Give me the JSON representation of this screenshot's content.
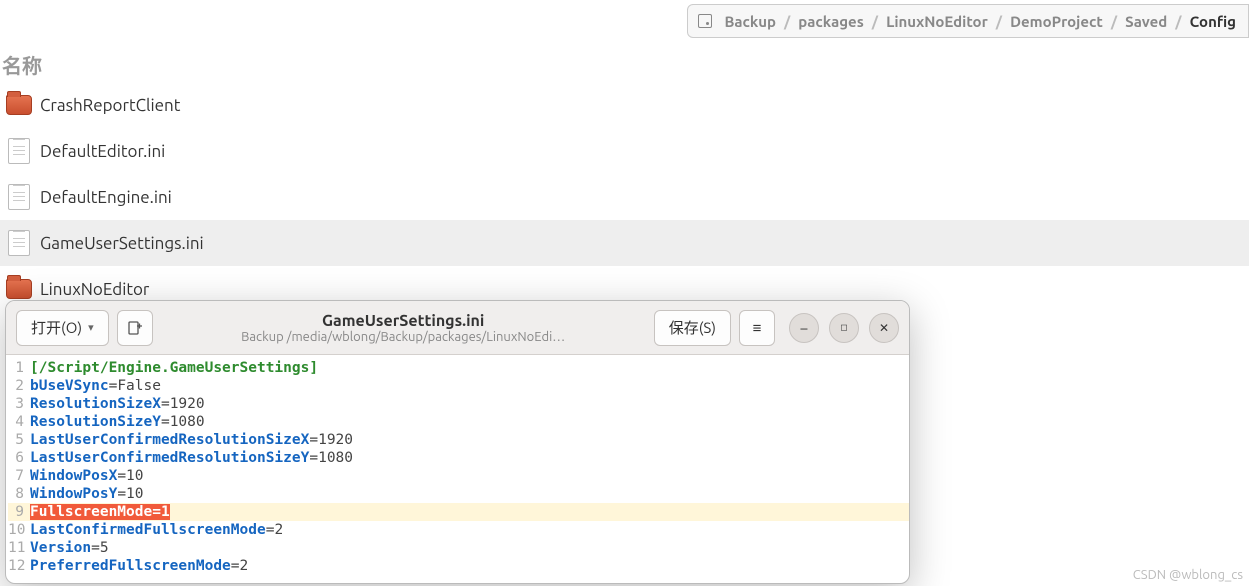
{
  "breadcrumb": {
    "items": [
      "Backup",
      "packages",
      "LinuxNoEditor",
      "DemoProject",
      "Saved",
      "Config"
    ]
  },
  "column_header": "名称",
  "files": [
    {
      "name": "CrashReportClient",
      "type": "folder"
    },
    {
      "name": "DefaultEditor.ini",
      "type": "file"
    },
    {
      "name": "DefaultEngine.ini",
      "type": "file"
    },
    {
      "name": "GameUserSettings.ini",
      "type": "file",
      "selected": true
    },
    {
      "name": "LinuxNoEditor",
      "type": "folder"
    }
  ],
  "editor": {
    "open_label": "打开(O)",
    "save_label": "保存(S)",
    "title": "GameUserSettings.ini",
    "subtitle": "Backup /media/wblong/Backup/packages/LinuxNoEdi…",
    "lines": [
      {
        "n": 1,
        "section": "[/Script/Engine.GameUserSettings]"
      },
      {
        "n": 2,
        "key": "bUseVSync",
        "val": "False"
      },
      {
        "n": 3,
        "key": "ResolutionSizeX",
        "val": "1920"
      },
      {
        "n": 4,
        "key": "ResolutionSizeY",
        "val": "1080"
      },
      {
        "n": 5,
        "key": "LastUserConfirmedResolutionSizeX",
        "val": "1920"
      },
      {
        "n": 6,
        "key": "LastUserConfirmedResolutionSizeY",
        "val": "1080"
      },
      {
        "n": 7,
        "key": "WindowPosX",
        "val": "10"
      },
      {
        "n": 8,
        "key": "WindowPosY",
        "val": "10"
      },
      {
        "n": 9,
        "key": "FullscreenMode",
        "val": "1",
        "highlight": true
      },
      {
        "n": 10,
        "key": "LastConfirmedFullscreenMode",
        "val": "2"
      },
      {
        "n": 11,
        "key": "Version",
        "val": "5"
      },
      {
        "n": 12,
        "key": "PreferredFullscreenMode",
        "val": "2"
      }
    ]
  },
  "watermark": "CSDN @wblong_cs"
}
